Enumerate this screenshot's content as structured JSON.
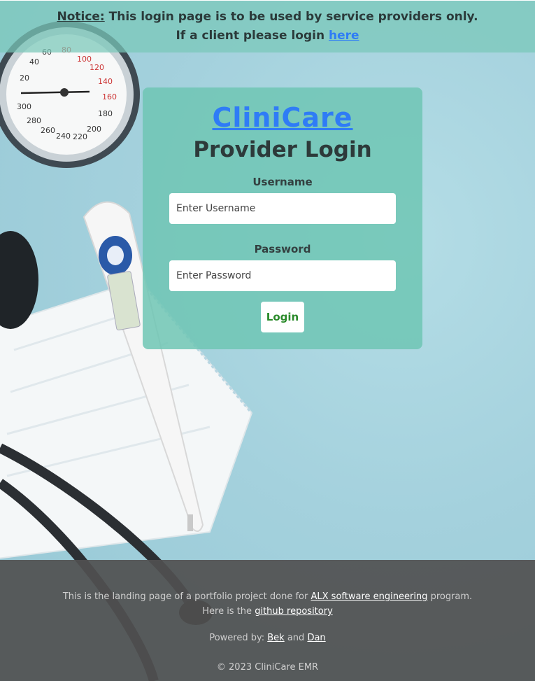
{
  "notice": {
    "label": "Notice:",
    "line1": "This login page is to be used by service providers only.",
    "line2": "If a client please login",
    "link": "here"
  },
  "card": {
    "brand": "CliniCare",
    "subtitle": "Provider Login",
    "username_label": "Username",
    "username_placeholder": "Enter Username",
    "password_label": "Password",
    "password_placeholder": "Enter Password",
    "login_label": "Login"
  },
  "footer": {
    "line1_text": "This is the landing page of a portfolio project done for",
    "alx_link": "ALX software engineering",
    "line1_end": "program.",
    "line2_text": "Here is the",
    "repo_link": "github repository",
    "powered_text": "Powered by:",
    "author1": "Bek",
    "and_text": "and",
    "author2": "Dan",
    "copyright": "© 2023 CliniCare EMR"
  },
  "colors": {
    "link": "#2f7cf6",
    "login_text": "#2a8a2a",
    "card_bg": "#6ec6b4",
    "footer_bg": "#505050"
  },
  "gauge": {
    "dial_numbers": [
      "20",
      "40",
      "60",
      "80",
      "100",
      "120",
      "140",
      "160",
      "180",
      "200",
      "220",
      "240",
      "260",
      "280",
      "300"
    ]
  }
}
